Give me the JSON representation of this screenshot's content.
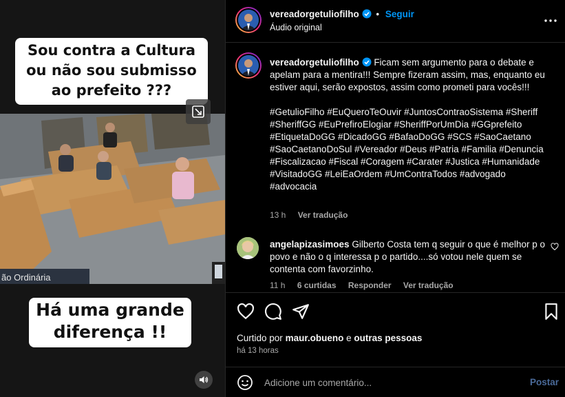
{
  "media": {
    "caption_top": "Sou contra a Cultura ou não sou submisso ao prefeito ???",
    "caption_bottom": "Há uma grande diferença !!",
    "video_text": "ão Ordinária",
    "expand_icon": "expand-icon",
    "audio_icon": "speaker-icon"
  },
  "header": {
    "username": "vereadorgetuliofilho",
    "verified_icon": "verified-badge-icon",
    "separator": "•",
    "follow_label": "Seguir",
    "audio_label": "Áudio original",
    "more_icon": "more-icon"
  },
  "post_caption": {
    "username": "vereadorgetuliofilho",
    "text": "Ficam sem argumento para o debate e apelam para a mentira!!! Sempre fizeram assim, mas, enquanto eu estiver aqui, serão expostos, assim como prometi para vocês!!!",
    "hashtags": "#GetulioFilho #EuQueroTeOuvir #JuntosContraoSistema #Sheriff #SheriffGG #EuPrefiroElogiar #SheriffPorUmDia #GGprefeito #EtiquetaDoGG #DicadoGG #BafaoDoGG #SCS #SaoCaetano #SaoCaetanoDoSul #Vereador #Deus #Patria #Familia #Denuncia #Fiscalizacao #Fiscal #Coragem #Carater #Justica #Humanidade #VisitadoGG #LeiEaOrdem #UmContraTodos #advogado #advocacia",
    "time": "13 h",
    "translate_label": "Ver tradução"
  },
  "comment": {
    "username": "angelapizasimoes",
    "text": "Gilberto Costa tem q seguir o que é melhor p o povo e não o q interessa p o partido....só votou nele quem se contenta com favorzinho.",
    "time": "11 h",
    "likes": "6 curtidas",
    "reply_label": "Responder",
    "translate_label": "Ver tradução",
    "like_icon": "heart-icon"
  },
  "actions": {
    "like_icon": "heart-icon",
    "comment_icon": "comment-icon",
    "share_icon": "send-icon",
    "save_icon": "bookmark-icon",
    "liked_prefix": "Curtido por",
    "liked_user": "maur.obueno",
    "liked_and": "e",
    "liked_others": "outras pessoas",
    "time_ago": "há 13 horas"
  },
  "add_comment": {
    "emoji_icon": "emoji-icon",
    "placeholder": "Adicione um comentário...",
    "post_label": "Postar"
  }
}
